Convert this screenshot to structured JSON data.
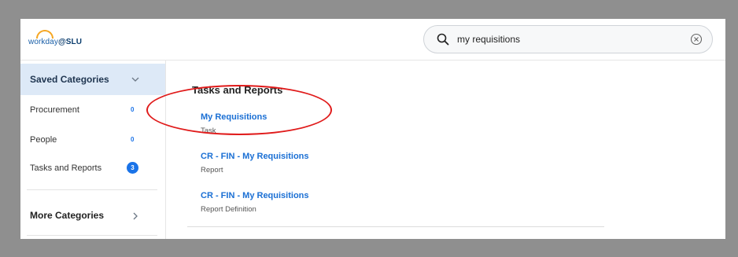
{
  "header": {
    "logo_prefix": "workday",
    "logo_suffix": "@SLU",
    "search": {
      "value": "my requisitions",
      "placeholder": "Search"
    }
  },
  "sidebar": {
    "saved_categories_label": "Saved Categories",
    "items": [
      {
        "label": "Procurement",
        "count": "0"
      },
      {
        "label": "People",
        "count": "0"
      },
      {
        "label": "Tasks and Reports",
        "count": "3"
      }
    ],
    "more_categories_label": "More Categories"
  },
  "main": {
    "section_title": "Tasks and Reports",
    "results": [
      {
        "title": "My Requisitions",
        "subtitle": "Task"
      },
      {
        "title": "CR - FIN - My Requisitions",
        "subtitle": "Report"
      },
      {
        "title": "CR - FIN - My Requisitions",
        "subtitle": "Report Definition"
      }
    ]
  },
  "colors": {
    "accent": "#1a73e8",
    "link": "#1a6fd4",
    "selected_bg": "#dde9f7",
    "annotation": "#e01b1b",
    "frame": "#8f8f8f"
  },
  "icons": {
    "search": "search-icon",
    "clear": "clear-icon",
    "saved_toggle": "chevron-down-icon",
    "more_toggle": "chevron-right-icon"
  }
}
